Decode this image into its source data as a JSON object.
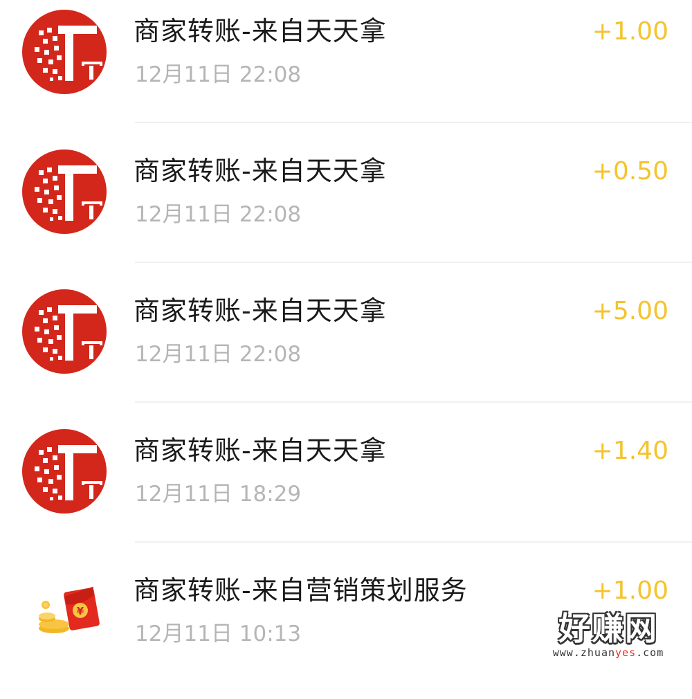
{
  "colors": {
    "amount": "#f5c32c",
    "title": "#1a1a1a",
    "time": "#b5b5b5",
    "avatar_red": "#d3271c",
    "divider": "#f0f0f0"
  },
  "transactions": [
    {
      "title": "商家转账-来自天天拿",
      "time": "12月11日 22:08",
      "amount": "+1.00",
      "avatar_icon": "tiantianna-logo-icon"
    },
    {
      "title": "商家转账-来自天天拿",
      "time": "12月11日 22:08",
      "amount": "+0.50",
      "avatar_icon": "tiantianna-logo-icon"
    },
    {
      "title": "商家转账-来自天天拿",
      "time": "12月11日 22:08",
      "amount": "+5.00",
      "avatar_icon": "tiantianna-logo-icon"
    },
    {
      "title": "商家转账-来自天天拿",
      "time": "12月11日 18:29",
      "amount": "+1.40",
      "avatar_icon": "tiantianna-logo-icon"
    },
    {
      "title": "商家转账-来自营销策划服务",
      "time": "12月11日 10:13",
      "amount": "+1.00",
      "avatar_icon": "red-envelope-coins-icon"
    }
  ],
  "watermark": {
    "logo": "好赚网",
    "url_prefix": "www.zhuan",
    "url_highlight": "yes",
    "url_suffix": ".com"
  }
}
